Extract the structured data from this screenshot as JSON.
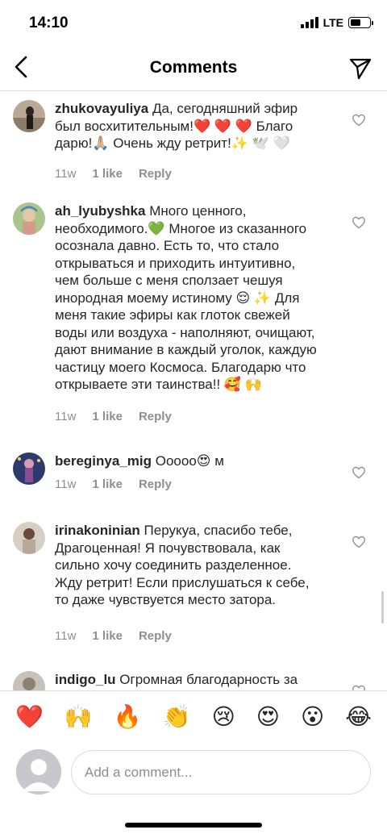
{
  "status_bar": {
    "time": "14:10",
    "network": "LTE"
  },
  "header": {
    "title": "Comments",
    "back_icon": "chevron-left-icon",
    "share_icon": "paper-plane-icon"
  },
  "comments": [
    {
      "username": "zhukovayuliya",
      "text": "Да, сегодняшний эфир был восхитительным!❤️ ❤️ ❤️ Благо дарю!🙏🏼 Очень жду ретрит!✨ 🕊️ 🤍",
      "age": "11w",
      "likes": "1 like",
      "reply": "Reply"
    },
    {
      "username": "ah_lyubyshka",
      "text": "Много ценного, необходимого.💚 Многое из сказанного осознала давно. Есть то, что стало открываться и приходить интуитивно, чем больше с меня сползает чешуя инородная моему истиному 😌 ✨ Для меня такие эфиры как глоток свежей воды или воздуха - наполняют, очищают, дают внимание в каждый уголок, каждую частицу моего Космоса. Благодарю что открываете эти таинства!! 🥰 🙌",
      "age": "11w",
      "likes": "1 like",
      "reply": "Reply"
    },
    {
      "username": "bereginya_mig",
      "text": "Ооооо😍 м",
      "age": "11w",
      "likes": "1 like",
      "reply": "Reply"
    },
    {
      "username": "irinakoninian",
      "text": "Перукуа, спасибо тебе, Драгоценная! Я почувствовала, как сильно хочу соединить разделенное. Жду ретрит! Если прислушаться к себе, то даже чувствуется место затора.",
      "age": "11w",
      "likes": "1 like",
      "reply": "Reply"
    },
    {
      "username": "indigo_lu",
      "text": "Огромная благодарность за",
      "age": "",
      "likes": "",
      "reply": ""
    }
  ],
  "reactions": [
    "❤️",
    "🙌",
    "🔥",
    "👏",
    "😢",
    "😍",
    "😮",
    "😂"
  ],
  "composer": {
    "placeholder": "Add a comment..."
  }
}
